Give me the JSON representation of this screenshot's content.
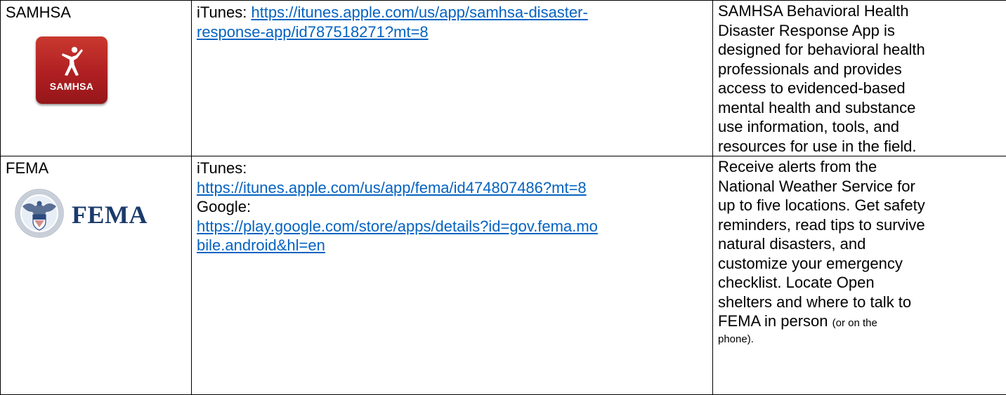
{
  "rows": [
    {
      "agency": "SAMHSA",
      "logo": {
        "icon": "samhsa-app-icon",
        "text": "SAMHSA",
        "color": "#b01f22"
      },
      "links": [
        {
          "label": "iTunes: ",
          "url_line1": "https://itunes.apple.com/us/app/samhsa-disaster-",
          "url_line2": "response-app/id787518271?mt=8"
        }
      ],
      "description_lines": [
        "SAMHSA Behavioral Health",
        "Disaster Response App is",
        "designed for behavioral health",
        "professionals and provides",
        "access to evidenced-based",
        "mental health and substance",
        "use information, tools, and",
        "resources for use in the field."
      ]
    },
    {
      "agency": "FEMA",
      "logo": {
        "icon": "dhs-seal-icon",
        "text": "FEMA",
        "color": "#1a3a6a"
      },
      "links": [
        {
          "label": "iTunes:",
          "url": "https://itunes.apple.com/us/app/fema/id474807486?mt=8"
        },
        {
          "label": "Google:",
          "url_line1": "https://play.google.com/store/apps/details?id=gov.fema.mo",
          "url_line2": "bile.android&hl=en"
        }
      ],
      "description_lines": [
        "Receive alerts from the",
        "National Weather Service for",
        "up to five locations. Get safety",
        "reminders, read tips to survive",
        "natural disasters, and",
        "customize your emergency",
        "checklist. Locate Open",
        "shelters and where to talk to"
      ],
      "description_last": "FEMA in person ",
      "description_small_1": "(or on the",
      "description_small_2": "phone)."
    }
  ],
  "colors": {
    "link": "#0563c1",
    "border": "#000000"
  }
}
